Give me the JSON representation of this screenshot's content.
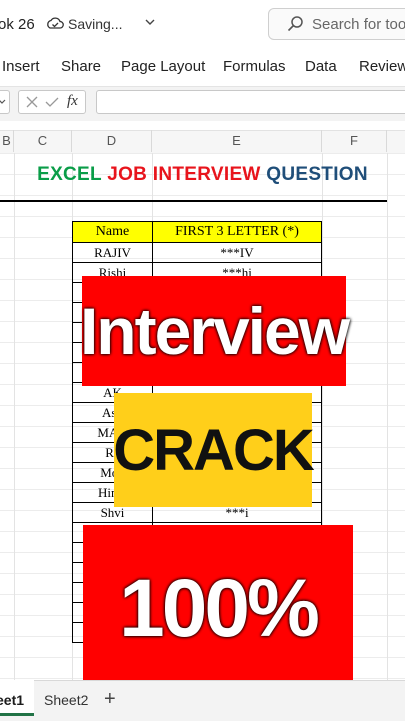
{
  "titlebar": {
    "workbook_name": "ok 26",
    "status": "Saving...",
    "search_placeholder": "Search for tool"
  },
  "ribbon": {
    "tabs": [
      "Insert",
      "Share",
      "Page Layout",
      "Formulas",
      "Data",
      "Review"
    ]
  },
  "formula_bar": {
    "fx_label": "fx",
    "value": ""
  },
  "columns": [
    "B",
    "C",
    "D",
    "E",
    "F"
  ],
  "sheet_title": {
    "part1": "EXCEL",
    "part2": "JOB INTERVIEW",
    "part3": "QUESTION"
  },
  "table": {
    "headers": [
      "Name",
      "FIRST 3 LETTER (*)"
    ],
    "rows": [
      [
        "RAJIV",
        "***IV"
      ],
      [
        "Rishi",
        "***hi"
      ],
      [
        "",
        ""
      ],
      [
        "",
        ""
      ],
      [
        "",
        ""
      ],
      [
        "",
        ""
      ],
      [
        "",
        ""
      ],
      [
        "AK",
        ""
      ],
      [
        "Ash",
        ""
      ],
      [
        "MAN",
        ""
      ],
      [
        "Ra",
        ""
      ],
      [
        "Moh",
        ""
      ],
      [
        "Hima",
        ""
      ],
      [
        "Shvi",
        "***i"
      ],
      [
        "",
        ""
      ],
      [
        "",
        ""
      ],
      [
        "",
        ""
      ],
      [
        "",
        ""
      ],
      [
        "",
        ""
      ],
      [
        "",
        ""
      ]
    ]
  },
  "overlays": {
    "interview": "Interview",
    "crack": "CRACK",
    "percent": "100%"
  },
  "sheets": {
    "sheet1": "eet1",
    "sheet2": "Sheet2",
    "add": "+"
  },
  "colors": {
    "title_green": "#0a9d48",
    "title_red": "#e8141c",
    "title_blue": "#1f4e79",
    "header_yellow": "#ffff00",
    "badge_red": "#ff0000",
    "badge_yellow": "#ffcf1a",
    "excel_green": "#217346"
  }
}
